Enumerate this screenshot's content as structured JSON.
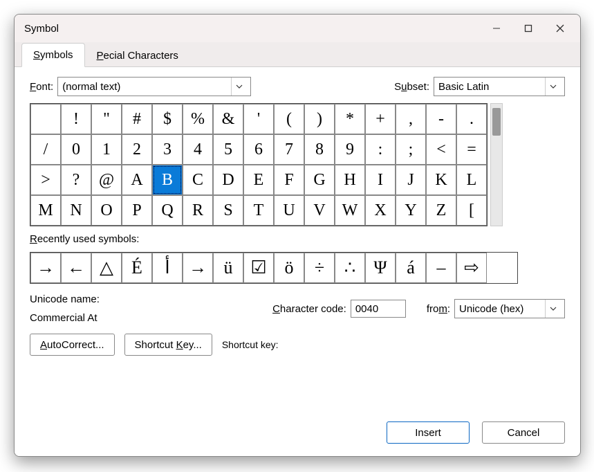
{
  "window": {
    "title": "Symbol"
  },
  "tabs": [
    "Symbols",
    "Special Characters"
  ],
  "activeTab": 0,
  "font": {
    "label": "Font:",
    "value": "(normal text)"
  },
  "subset": {
    "label": "Subset:",
    "value": "Basic Latin"
  },
  "selectedIndex": 34,
  "symbols": [
    " ",
    "!",
    "\"",
    "#",
    "$",
    "%",
    "&",
    "'",
    "(",
    ")",
    "*",
    "+",
    ",",
    "-",
    ".",
    "/",
    "0",
    "1",
    "2",
    "3",
    "4",
    "5",
    "6",
    "7",
    "8",
    "9",
    ":",
    ";",
    "<",
    "=",
    ">",
    "?",
    "@",
    "A",
    "B",
    "C",
    "D",
    "E",
    "F",
    "G",
    "H",
    "I",
    "J",
    "K",
    "L",
    "M",
    "N",
    "O",
    "P",
    "Q",
    "R",
    "S",
    "T",
    "U",
    "V",
    "W",
    "X",
    "Y",
    "Z",
    "["
  ],
  "cols": 15,
  "recentLabel": "Recently used symbols:",
  "recent": [
    "→",
    "←",
    "△",
    "É",
    "أ",
    "→",
    "ü",
    "☑",
    "ö",
    "÷",
    "∴",
    "Ψ",
    "á",
    "–",
    "⇨"
  ],
  "recentCols": 16,
  "unicodeNameLabel": "Unicode name:",
  "unicodeName": "Commercial At",
  "charCodeLabel": "Character code:",
  "charCode": "0040",
  "fromLabel": "from:",
  "fromValue": "Unicode (hex)",
  "autoCorrectBtn": "AutoCorrect...",
  "shortcutKeyBtn": "Shortcut Key...",
  "shortcutLabel": "Shortcut key:",
  "shortcutValue": "",
  "insertBtn": "Insert",
  "cancelBtn": "Cancel"
}
